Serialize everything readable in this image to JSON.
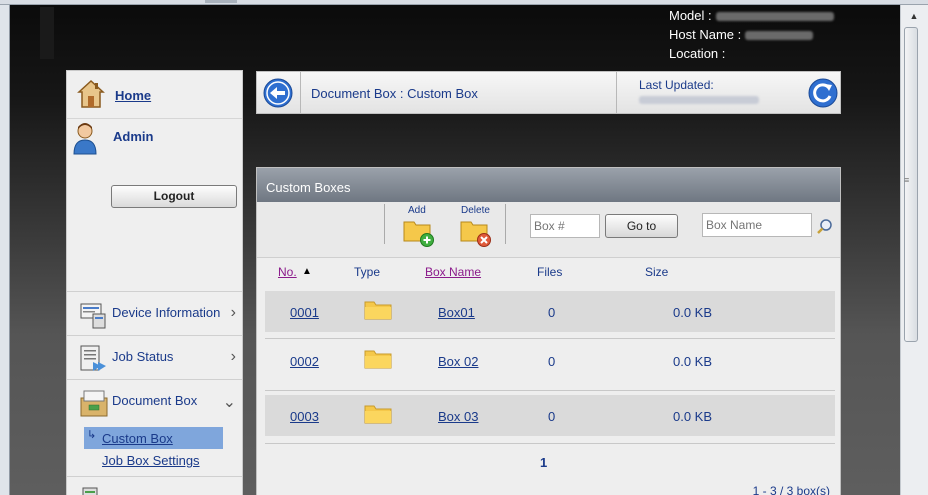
{
  "device_info": {
    "model_label": "Model :",
    "host_label": "Host Name :",
    "location_label": "Location :"
  },
  "sidebar": {
    "home_label": "Home",
    "admin_label": "Admin",
    "logout_label": "Logout",
    "items": [
      {
        "label": "Device Information",
        "icon": "device-info-icon",
        "chevron": "›"
      },
      {
        "label": "Job Status",
        "icon": "job-status-icon",
        "chevron": "›"
      },
      {
        "label": "Document Box",
        "icon": "document-box-icon",
        "chevron": "⌄"
      }
    ],
    "sub_items": [
      {
        "label": "Custom Box",
        "selected": true
      },
      {
        "label": "Job Box Settings",
        "selected": false
      }
    ]
  },
  "header": {
    "breadcrumb": "Document Box : Custom Box",
    "last_updated_label": "Last Updated:"
  },
  "panel": {
    "title": "Custom Boxes",
    "toolbar": {
      "add_label": "Add",
      "delete_label": "Delete",
      "box_number_placeholder": "Box #",
      "goto_label": "Go to",
      "box_name_placeholder": "Box Name"
    },
    "columns": {
      "no": "No.",
      "sort_indicator": "▲",
      "type": "Type",
      "box_name": "Box Name",
      "files": "Files",
      "size": "Size"
    },
    "rows": [
      {
        "no": "0001",
        "name": "Box01",
        "files": "0",
        "size": "0.0 KB"
      },
      {
        "no": "0002",
        "name": "Box 02",
        "files": "0",
        "size": "0.0 KB"
      },
      {
        "no": "0003",
        "name": "Box 03",
        "files": "0",
        "size": "0.0 KB"
      }
    ],
    "page_number": "1",
    "count_text": "1 - 3 / 3 box(s)"
  },
  "colors": {
    "link": "#1a3a8a",
    "visited": "#8b1a8b",
    "selected_bg": "#7fa6dc",
    "folder": "#f5c84a"
  }
}
